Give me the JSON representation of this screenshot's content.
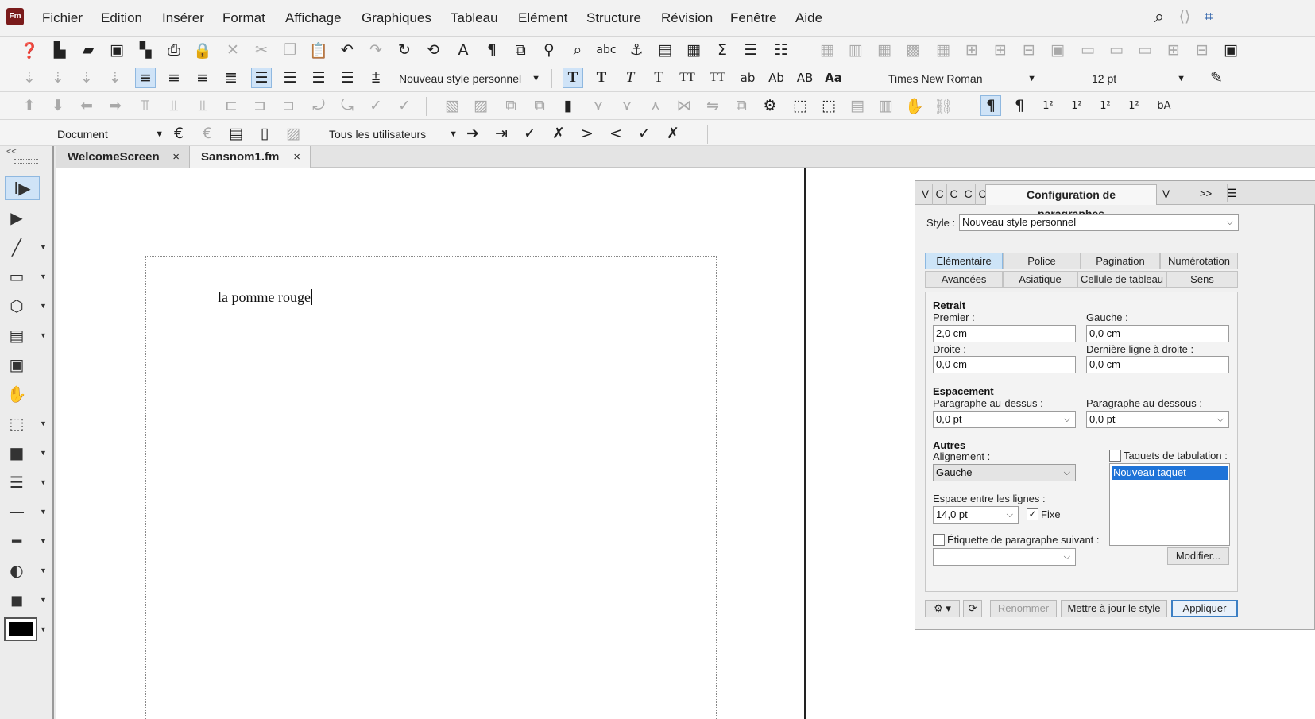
{
  "app": {
    "logo": "Fm"
  },
  "menu": [
    "Fichier",
    "Edition",
    "Insérer",
    "Format",
    "Affichage",
    "Graphiques",
    "Tableau",
    "Elément",
    "Structure",
    "Révision",
    "Fenêtre",
    "Aide"
  ],
  "toolbar2": {
    "style_dropdown": "Nouveau style personnel",
    "font_dropdown": "Times New Roman",
    "size_dropdown": "12 pt",
    "text_buttons": [
      "T",
      "T",
      "T",
      "T",
      "TT",
      "TT",
      "ab",
      "Ab",
      "AB",
      "Aa"
    ]
  },
  "toolbar4": {
    "scope_dropdown": "Document",
    "users_dropdown": "Tous les utilisateurs"
  },
  "tool_panel": {
    "collapse": "<<"
  },
  "tabs": [
    {
      "label": "WelcomeScreen",
      "close": "×"
    },
    {
      "label": "Sansnom1.fm",
      "close": "×"
    }
  ],
  "document": {
    "text": "la pomme rouge"
  },
  "panel": {
    "title": "Configuration de paragraphes",
    "collapsed_tabs": [
      "V",
      "C",
      "C",
      "C",
      "C"
    ],
    "right_tab": "V",
    "overflow": ">>",
    "style_label": "Style :",
    "style_value": "Nouveau style personnel",
    "tabs_row1": [
      "Elémentaire",
      "Police",
      "Pagination",
      "Numérotation"
    ],
    "tabs_row2": [
      "Avancées",
      "Asiatique",
      "Cellule de tableau",
      "Sens"
    ],
    "retrait": {
      "heading": "Retrait",
      "premier_label": "Premier :",
      "premier_value": "2,0 cm",
      "gauche_label": "Gauche :",
      "gauche_value": "0,0 cm",
      "droite_label": "Droite :",
      "droite_value": "0,0 cm",
      "derniere_label": "Dernière ligne à droite :",
      "derniere_value": "0,0 cm"
    },
    "espacement": {
      "heading": "Espacement",
      "dessus_label": "Paragraphe au-dessus :",
      "dessus_value": "0,0 pt",
      "dessous_label": "Paragraphe au-dessous :",
      "dessous_value": "0,0 pt"
    },
    "autres": {
      "heading": "Autres",
      "alignement_label": "Alignement :",
      "alignement_value": "Gauche",
      "interligne_label": "Espace entre les lignes :",
      "interligne_value": "14,0 pt",
      "fixe_label": "Fixe",
      "fixe_checked": "✓",
      "etiquette_label": "Étiquette de paragraphe suivant :",
      "etiquette_value": "",
      "taquets_label": "Taquets de tabulation :",
      "taquets_items": [
        "Nouveau taquet"
      ],
      "modifier_label": "Modifier..."
    },
    "footer": {
      "renommer": "Renommer",
      "mettre_a_jour": "Mettre à jour le style",
      "appliquer": "Appliquer"
    }
  }
}
